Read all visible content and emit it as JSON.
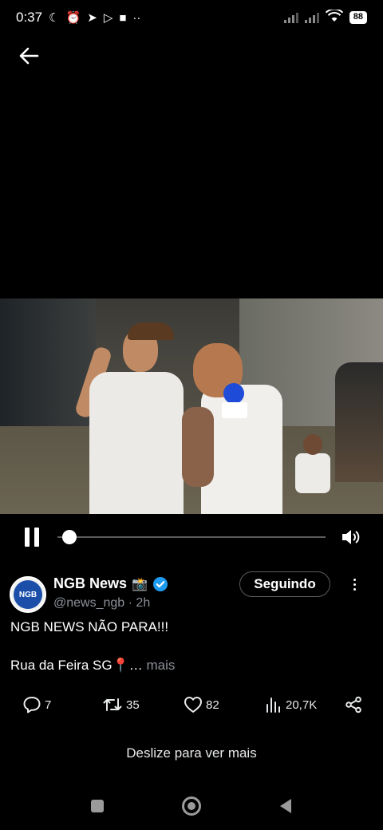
{
  "status_bar": {
    "time": "0:37",
    "battery": "88",
    "left_icons": [
      "moon-icon",
      "alarm-icon",
      "telegram-icon",
      "play-store-icon",
      "square-icon",
      "dots-icon"
    ],
    "right_icons": [
      "signal-icon",
      "signal-icon",
      "wifi-icon",
      "battery-icon"
    ]
  },
  "video": {
    "progress": 0.02
  },
  "tweet": {
    "display_name": "NGB News",
    "name_emoji": "📸",
    "handle": "@news_ngb",
    "time": "· 2h",
    "follow_label": "Seguindo",
    "avatar_text": "NGB",
    "text_line1": "NGB NEWS NÃO PARA!!!",
    "text_line2": "Rua da Feira SG📍…",
    "more_label": "mais"
  },
  "actions": {
    "replies": "7",
    "retweets": "35",
    "likes": "82",
    "views": "20,7K"
  },
  "swipe_hint": "Deslize para ver mais",
  "colors": {
    "background": "#000000",
    "secondary_text": "#8b9097",
    "verified": "#1d9bf0"
  }
}
